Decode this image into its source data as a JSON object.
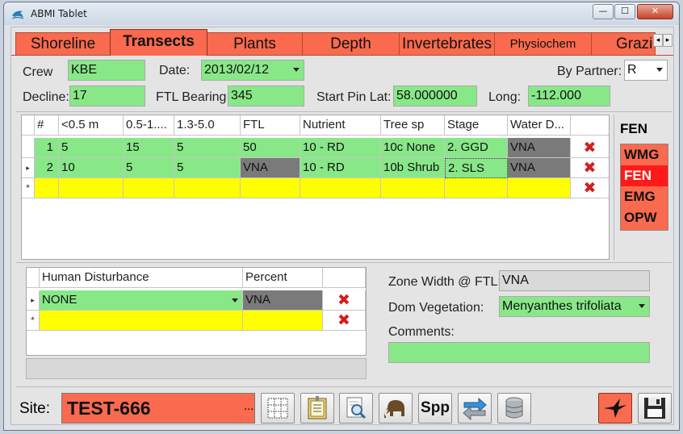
{
  "window": {
    "title": "ABMI Tablet"
  },
  "tabs": [
    {
      "label": "Shoreline"
    },
    {
      "label": "Transects"
    },
    {
      "label": "Plants"
    },
    {
      "label": "Depth"
    },
    {
      "label": "Invertebrates"
    },
    {
      "label": "Physiochem"
    },
    {
      "label": "Grazi"
    }
  ],
  "header": {
    "crew_label": "Crew",
    "crew_value": "KBE",
    "date_label": "Date:",
    "date_value": "2013/02/12",
    "partner_label": "By Partner:",
    "partner_value": "R",
    "decline_label": "Decline:",
    "decline_value": "17",
    "ftl_bearing_label": "FTL Bearing:",
    "ftl_bearing_value": "345",
    "start_lat_label": "Start Pin Lat:",
    "start_lat_value": "58.000000",
    "long_label": "Long:",
    "long_value": "-112.000"
  },
  "transect_grid": {
    "columns": [
      "#",
      "<0.5 m",
      "0.5-1....",
      "1.3-5.0",
      "FTL",
      "Nutrient",
      "Tree sp",
      "Stage",
      "Water D..."
    ],
    "rows": [
      {
        "n": "1",
        "c1": "5",
        "c2": "15",
        "c3": "5",
        "ftl": "50",
        "nutrient": "10 - RD",
        "tree": "10c None",
        "stage": "2. GGD",
        "water": "VNA"
      },
      {
        "n": "2",
        "c1": "10",
        "c2": "5",
        "c3": "5",
        "ftl": "VNA",
        "nutrient": "10 - RD",
        "tree": "10b Shrub",
        "stage": "2. SLS",
        "water": "VNA"
      }
    ],
    "new_row_marker": "*",
    "current_row_marker": "▸"
  },
  "zones": {
    "header": "FEN",
    "items": [
      {
        "label": "WMG"
      },
      {
        "label": "FEN"
      },
      {
        "label": "EMG"
      },
      {
        "label": "OPW"
      }
    ],
    "selected": "FEN"
  },
  "disturbance_grid": {
    "columns": [
      "Human Disturbance",
      "Percent"
    ],
    "rows": [
      {
        "disturbance": "NONE",
        "percent": "VNA"
      }
    ]
  },
  "zone_info": {
    "width_label": "Zone Width @ FTL:",
    "width_value": "VNA",
    "veg_label": "Dom Vegetation:",
    "veg_value": "Menyanthes trifoliata",
    "comments_label": "Comments:",
    "comments_value": ""
  },
  "bottom": {
    "site_label": "Site:",
    "site_value": "TEST-666",
    "ellipsis": "...",
    "spp_label": "Spp"
  },
  "icons": {
    "grid": "grid-icon",
    "notebook": "notebook-icon",
    "magnifier": "magnifier-icon",
    "mammoth": "mammoth-icon",
    "sync": "sync-arrows-icon",
    "database": "database-icon",
    "bird": "bird-icon",
    "save": "save-icon"
  },
  "colors": {
    "tab": "#f96a4e",
    "field_green": "#88e888",
    "new_row_yellow": "#ffff00",
    "vna_gray": "#7a7a7a",
    "delete_red": "#d11e1e",
    "zone_selected": "#ff1a1a"
  }
}
